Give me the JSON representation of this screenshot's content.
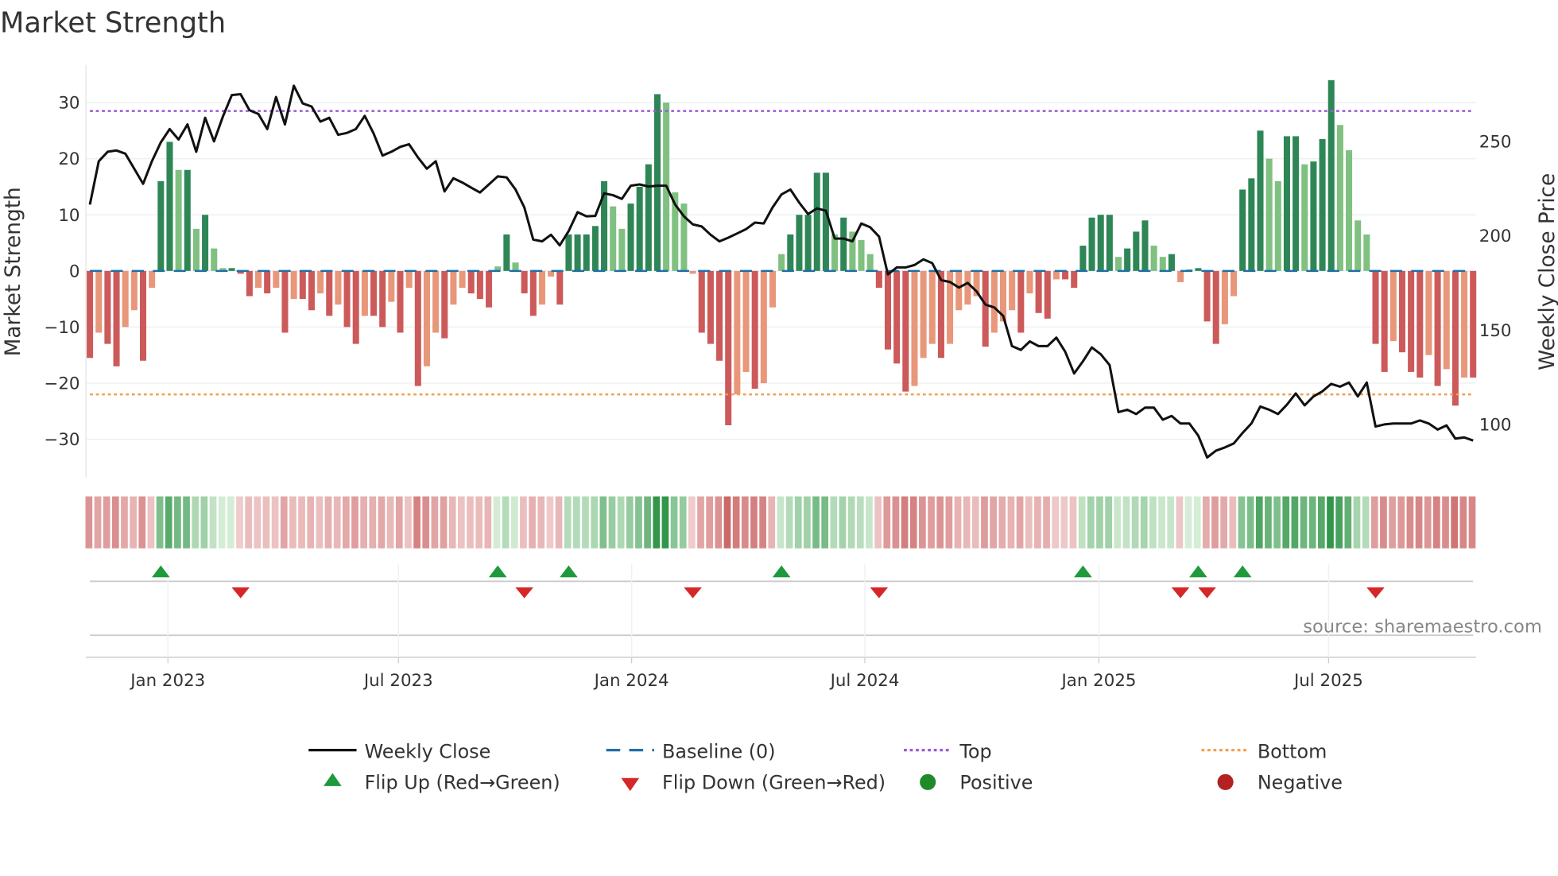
{
  "title": "Market Strength",
  "source": "source: sharemaestro.com",
  "colors": {
    "pos_dark": "#2e8656",
    "pos_light": "#80c080",
    "neg_dark": "#cc5a5a",
    "neg_light": "#e8977a",
    "line": "#111111",
    "baseline": "#1f6fa8",
    "top": "#9b59d6",
    "bottom": "#f0a050",
    "flip_up": "#1e9a3c",
    "flip_down": "#d62728",
    "positive": "#1e8a2a",
    "negative": "#b22222"
  },
  "chart_data": {
    "type": "bar",
    "title": "Market Strength",
    "ylabel": "Market Strength",
    "y2label": "Weekly Close Price",
    "ylim": [
      -36.8,
      36.7
    ],
    "y2lim": [
      71.4,
      290
    ],
    "yticks": [
      30,
      20,
      10,
      0,
      -10,
      -20,
      -30
    ],
    "ytick_labels": [
      "30",
      "20",
      "10",
      "0",
      "−10",
      "−20",
      "−30"
    ],
    "y2ticks": [
      250,
      200,
      150,
      100
    ],
    "y2tick_labels": [
      "250",
      "200",
      "150",
      "100"
    ],
    "top_level": 28.5,
    "bottom_level": -22,
    "baseline": 0,
    "xticks": [
      {
        "label": "Jan 2023",
        "week": 8.8
      },
      {
        "label": "Jul 2023",
        "week": 34.8
      },
      {
        "label": "Jan 2024",
        "week": 61.1
      },
      {
        "label": "Jul 2024",
        "week": 87.4
      },
      {
        "label": "Jan 2025",
        "week": 113.8
      },
      {
        "label": "Jul 2025",
        "week": 139.7
      }
    ],
    "strength": [
      -15.5,
      -11,
      -13,
      -17,
      -10,
      -7,
      -16,
      -3,
      16,
      23,
      18,
      18,
      7.5,
      10,
      4,
      0.5,
      0.5,
      -0.5,
      -4.5,
      -3,
      -4,
      -3,
      -11,
      -5,
      -5,
      -7,
      -4,
      -8,
      -6,
      -10,
      -13,
      -8,
      -8,
      -10,
      -5.5,
      -11,
      -3,
      -20.5,
      -17,
      -11,
      -12,
      -6,
      -3,
      -4,
      -5,
      -6.5,
      0.8,
      6.5,
      1.5,
      -4,
      -8,
      -6,
      -1,
      -6,
      6.5,
      6.5,
      6.5,
      8,
      16,
      11.5,
      7.5,
      12,
      15,
      19,
      31.5,
      30,
      14,
      12,
      -0.5,
      -11,
      -13,
      -16,
      -27.5,
      -22,
      -18,
      -21,
      -20,
      -6.5,
      3,
      6.5,
      10,
      10,
      17.5,
      17.5,
      6.5,
      9.5,
      7,
      5.5,
      3,
      -3,
      -14,
      -16.5,
      -21.5,
      -20.5,
      -15.5,
      -13,
      -15.5,
      -13,
      -7,
      -6,
      -4.5,
      -13.5,
      -11,
      -9,
      -7,
      -11,
      -4,
      -7.5,
      -8.5,
      -1.5,
      -1.5,
      -3,
      4.5,
      9.5,
      10,
      10,
      2.5,
      4,
      7,
      9,
      4.5,
      2.5,
      3,
      -2,
      0.3,
      0.5,
      -9,
      -13,
      -9.5,
      -4.5,
      14.5,
      16.5,
      25,
      20,
      16,
      24,
      24,
      19,
      19.5,
      23.5,
      34,
      26,
      21.5,
      9,
      6.5,
      -13,
      -18,
      -12.5,
      -14.5,
      -18,
      -19,
      -15,
      -20.5,
      -17.5,
      -24,
      -19,
      -19
    ],
    "weekly_close": [
      216,
      239,
      244,
      244.7,
      243,
      235,
      227,
      239,
      249,
      256,
      250.5,
      258.5,
      244,
      262,
      249.5,
      262.7,
      274,
      274.5,
      266,
      264,
      256,
      273,
      258.5,
      279,
      269.6,
      268,
      260,
      262,
      253,
      254,
      256,
      263,
      253.7,
      242,
      244,
      246.6,
      248,
      241,
      235,
      239,
      223,
      230,
      227.7,
      225,
      222.4,
      226.7,
      231,
      230.4,
      224,
      214.5,
      197.5,
      196.5,
      200,
      194.4,
      202,
      212,
      209.8,
      210,
      222,
      221,
      219,
      226,
      226.7,
      225.6,
      226,
      226,
      216,
      209.8,
      205.5,
      204.4,
      200,
      196.5,
      198.5,
      200.7,
      203,
      206.5,
      206,
      214.5,
      221.4,
      224,
      217,
      211,
      214,
      212.8,
      198,
      198,
      196.5,
      206,
      204,
      199,
      179,
      182.7,
      182.7,
      184,
      187,
      185,
      176,
      175,
      172,
      174.5,
      170,
      163,
      161.5,
      157,
      141,
      139,
      143.5,
      141,
      141,
      145.5,
      138,
      126.5,
      133,
      140.3,
      136.7,
      131,
      106,
      107.3,
      105,
      108.4,
      108.4,
      102,
      104,
      100,
      100,
      93.6,
      82,
      85.6,
      87.3,
      89.4,
      95,
      100,
      109,
      107.3,
      105,
      110,
      115.9,
      109.6,
      114.3,
      117,
      121,
      119.5,
      121.7,
      114.3,
      121.7,
      98.4,
      99.5,
      100,
      100,
      100,
      101.6,
      100,
      96.8,
      99,
      92,
      92.6,
      91
    ],
    "flip_up_weeks": [
      8,
      46,
      54,
      78,
      112,
      125,
      130
    ],
    "flip_down_weeks": [
      17,
      49,
      68,
      89,
      123,
      126,
      145
    ]
  },
  "legend": {
    "weekly_close": "Weekly Close",
    "baseline": "Baseline (0)",
    "top": "Top",
    "bottom": "Bottom",
    "flip_up": "Flip Up (Red→Green)",
    "flip_down": "Flip Down (Green→Red)",
    "positive": "Positive",
    "negative": "Negative"
  }
}
